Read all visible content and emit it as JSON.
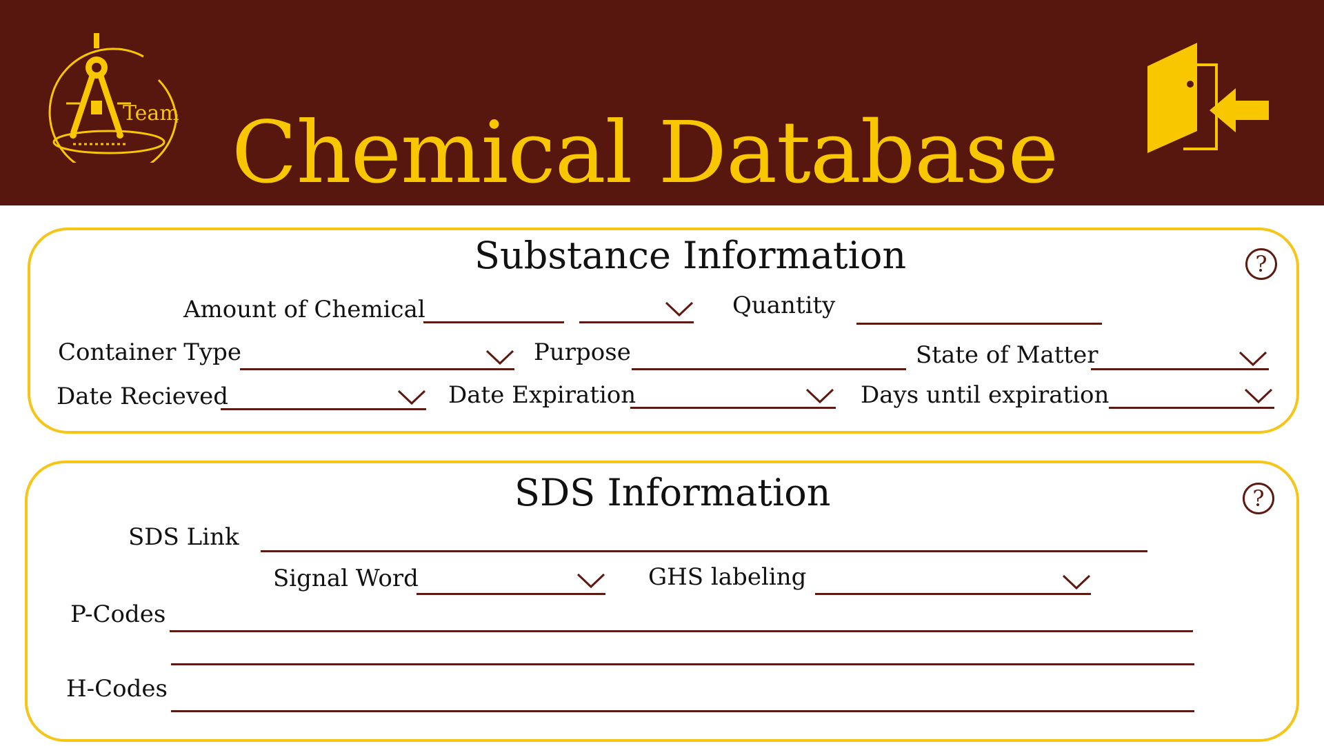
{
  "header": {
    "title": "Chemical Database",
    "logo_text": "Team",
    "exit_icon": "door-exit-icon",
    "colors": {
      "background": "#58170e",
      "accent": "#f9c700"
    }
  },
  "substance": {
    "title": "Substance Information",
    "help_icon": "question-icon",
    "help_glyph": "?",
    "amount_label": "Amount of Chemical",
    "quantity_label": "Quantity",
    "container_label": "Container Type",
    "purpose_label": "Purpose",
    "state_label": "State of Matter",
    "date_received_label": "Date Recieved",
    "date_expiration_label": "Date Expiration",
    "days_until_label": "Days until expiration"
  },
  "sds": {
    "title": "SDS Information",
    "help_icon": "question-icon",
    "help_glyph": "?",
    "link_label": "SDS Link",
    "signal_label": "Signal Word",
    "ghs_label": "GHS labeling",
    "pcodes_label": "P-Codes",
    "hcodes_label": "H-Codes"
  },
  "colors": {
    "panel_border": "#f5c518",
    "field_line": "#5c1a10"
  }
}
